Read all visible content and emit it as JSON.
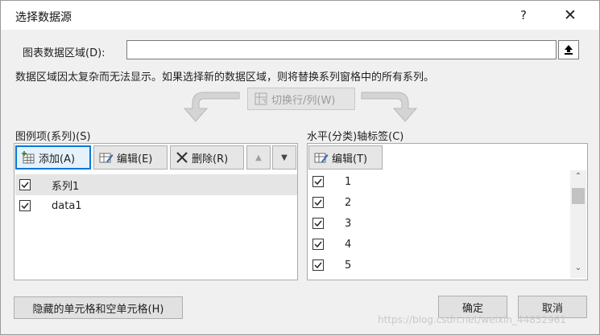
{
  "window": {
    "title": "选择数据源",
    "help_label": "?",
    "close_label": "✕"
  },
  "range": {
    "label": "图表数据区域(D):",
    "value": ""
  },
  "notice": "数据区域因太复杂而无法显示。如果选择新的数据区域，则将替换系列窗格中的所有系列。",
  "switch_button": {
    "label": "切换行/列(W)"
  },
  "legend_entries": {
    "label": "图例项(系列)(S)",
    "add_label": "添加(A)",
    "edit_label": "编辑(E)",
    "delete_label": "删除(R)",
    "move_up_label": "▲",
    "move_down_label": "▼",
    "items": [
      {
        "label": "系列1",
        "checked": true,
        "selected": true
      },
      {
        "label": "data1",
        "checked": true,
        "selected": false
      }
    ]
  },
  "axis_labels": {
    "label": "水平(分类)轴标签(C)",
    "edit_label": "编辑(T)",
    "items": [
      {
        "label": "1",
        "checked": true
      },
      {
        "label": "2",
        "checked": true
      },
      {
        "label": "3",
        "checked": true
      },
      {
        "label": "4",
        "checked": true
      },
      {
        "label": "5",
        "checked": true
      }
    ]
  },
  "footer": {
    "hidden_cells_label": "隐藏的单元格和空单元格(H)",
    "ok_label": "确定",
    "cancel_label": "取消"
  },
  "watermark": "https://blog.csdn.net/weixin_44852961",
  "colors": {
    "accent": "#0078d7",
    "dialog_bg": "#f0f0f0",
    "selection": "#e5e5e5"
  }
}
